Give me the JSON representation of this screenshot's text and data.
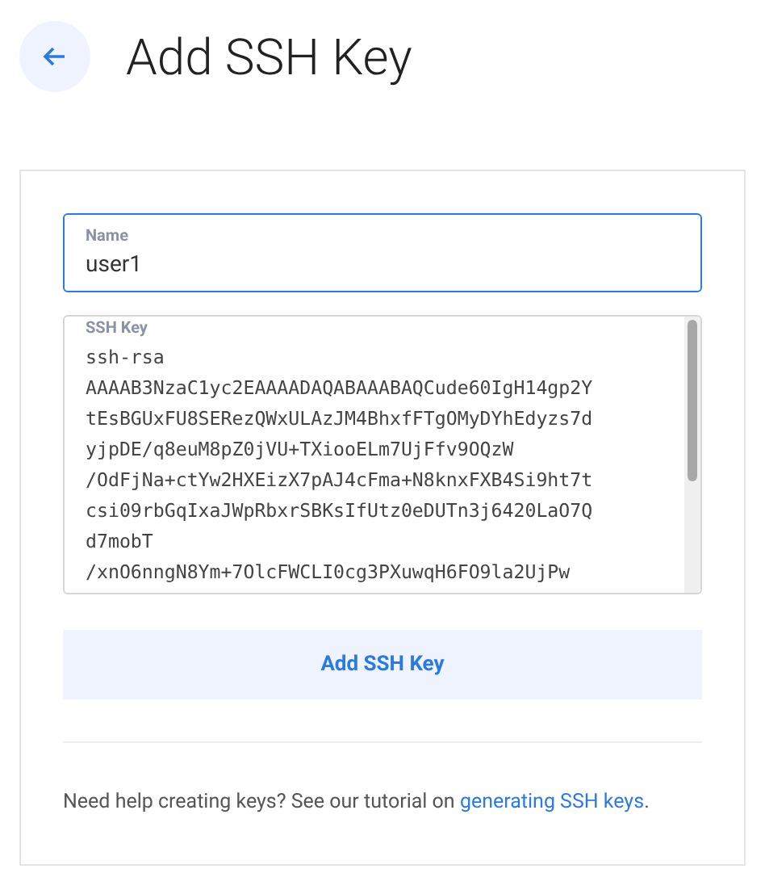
{
  "header": {
    "title": "Add SSH Key"
  },
  "form": {
    "name_field": {
      "label": "Name",
      "value": "user1",
      "focused": true
    },
    "key_field": {
      "label": "SSH Key",
      "lines": [
        "ssh-rsa",
        "AAAAB3NzaC1yc2EAAAADAQABAAABAQCude60IgH14gp2Y",
        "tEsBGUxFU8SERezQWxULAzJM4BhxfFTgOMyDYhEdyzs7d",
        "yjpDE/q8euM8pZ0jVU+TXiooELm7UjFfv9OQzW",
        "/OdFjNa+ctYw2HXEizX7pAJ4cFma+N8knxFXB4Si9ht7t",
        "csi09rbGqIxaJWpRbxrSBKsIfUtz0eDUTn3j6420LaO7Q",
        "d7mobT",
        "/xnO6nngN8Ym+7OlcFWCLI0cg3PXuwqH6FO9la2UjPw"
      ],
      "focused": false
    },
    "submit": "Add SSH Key",
    "help": {
      "before": "Need help creating keys? See our tutorial on ",
      "link": "generating SSH keys",
      "after": "."
    }
  }
}
